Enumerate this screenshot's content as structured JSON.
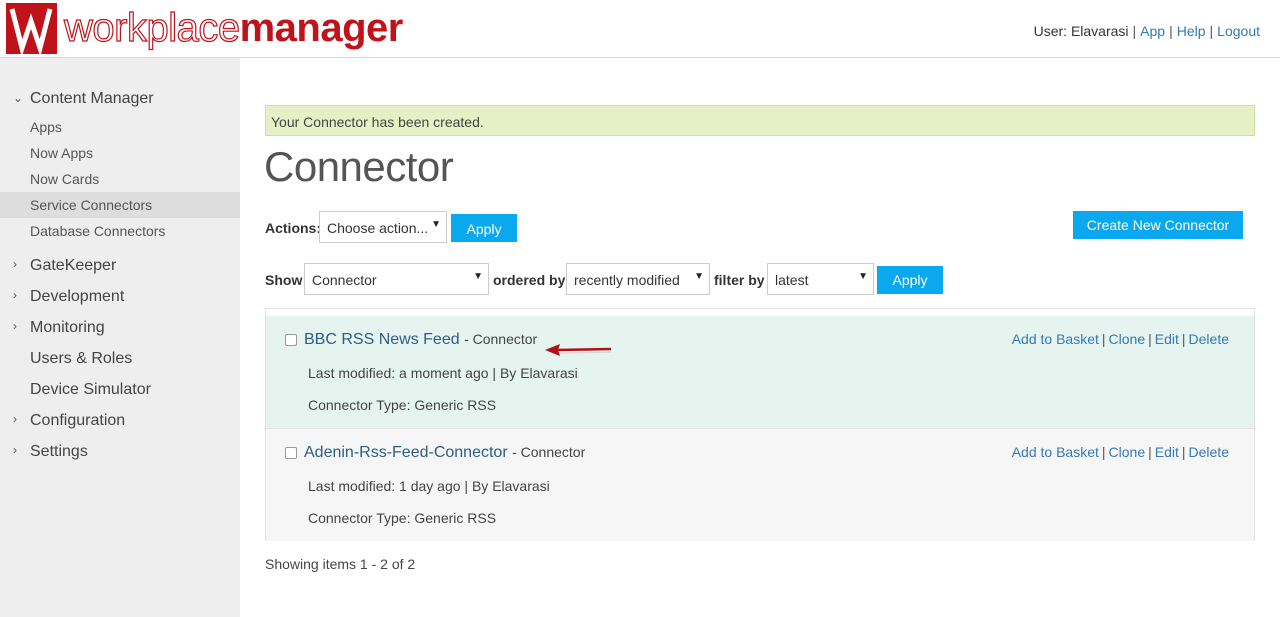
{
  "header": {
    "logo_light": "workplace",
    "logo_bold": "manager",
    "user_label": "User: Elavarasi",
    "nav": [
      "App",
      "Help",
      "Logout"
    ]
  },
  "sidebar": {
    "content_manager": {
      "label": "Content Manager",
      "items": [
        "Apps",
        "Now Apps",
        "Now Cards",
        "Service Connectors",
        "Database Connectors"
      ]
    },
    "groups": [
      "GateKeeper",
      "Development",
      "Monitoring",
      "Users & Roles",
      "Device Simulator",
      "Configuration",
      "Settings"
    ]
  },
  "alert": "Your Connector has been created.",
  "page_title": "Connector",
  "actions": {
    "label": "Actions:",
    "select_value": "Choose action...",
    "apply": "Apply",
    "create": "Create New Connector"
  },
  "filters": {
    "show_label": "Show",
    "show_value": "Connector",
    "ordered_label": "ordered by",
    "ordered_value": "recently modified",
    "filter_label": "filter by",
    "filter_value": "latest",
    "apply": "Apply"
  },
  "items": [
    {
      "title": "BBC RSS News Feed",
      "type": "- Connector",
      "modified": "Last modified: a moment ago | By Elavarasi",
      "connector_type": "Connector Type: Generic RSS"
    },
    {
      "title": "Adenin-Rss-Feed-Connector",
      "type": "- Connector",
      "modified": "Last modified: 1 day ago | By Elavarasi",
      "connector_type": "Connector Type: Generic RSS"
    }
  ],
  "row_actions": [
    "Add to Basket",
    "Clone",
    "Edit",
    "Delete"
  ],
  "footer": "Showing items 1 - 2 of 2",
  "colors": {
    "brand": "#c0121a",
    "button": "#0aa8ef",
    "arrow": "#b01018"
  }
}
